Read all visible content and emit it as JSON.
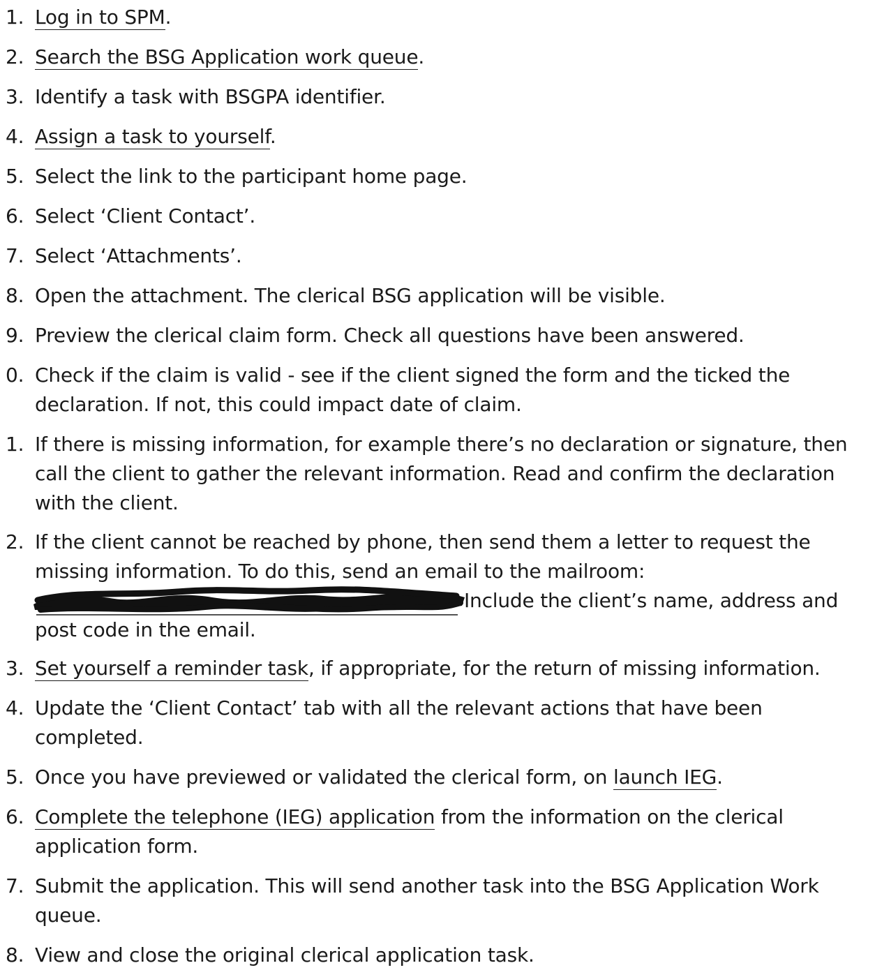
{
  "steps": [
    {
      "num": "1.",
      "parts": [
        {
          "t": "Log in to SPM",
          "link": true
        },
        {
          "t": "."
        }
      ]
    },
    {
      "num": "2.",
      "parts": [
        {
          "t": "Search the BSG Application work queue",
          "link": true
        },
        {
          "t": "."
        }
      ]
    },
    {
      "num": "3.",
      "parts": [
        {
          "t": "Identify a task with BSGPA identifier."
        }
      ]
    },
    {
      "num": "4.",
      "parts": [
        {
          "t": "Assign a task to yourself",
          "link": true
        },
        {
          "t": "."
        }
      ]
    },
    {
      "num": "5.",
      "parts": [
        {
          "t": "Select the link to the participant home page."
        }
      ]
    },
    {
      "num": "6.",
      "parts": [
        {
          "t": "Select ‘Client Contact’."
        }
      ]
    },
    {
      "num": "7.",
      "parts": [
        {
          "t": "Select ‘Attachments’."
        }
      ]
    },
    {
      "num": "8.",
      "parts": [
        {
          "t": "Open the attachment. The clerical BSG application will be visible."
        }
      ]
    },
    {
      "num": "9.",
      "parts": [
        {
          "t": "Preview the clerical claim form. Check all questions have been answered."
        }
      ]
    },
    {
      "num": "0.",
      "lines": [
        [
          {
            "t": "Check if the claim is valid - see if the client signed the form and the ticked the"
          }
        ],
        [
          {
            "t": "declaration. If not, this could impact date of claim."
          }
        ]
      ]
    },
    {
      "num": "1.",
      "lines": [
        [
          {
            "t": "If there is missing information, for example there’s no declaration or signature, then"
          }
        ],
        [
          {
            "t": "call the client to gather the relevant information. Read and confirm the declaration"
          }
        ],
        [
          {
            "t": "with the client."
          }
        ]
      ]
    },
    {
      "num": "2.",
      "lines": [
        [
          {
            "t": "If the client cannot be reached by phone, then send them a letter to request the"
          }
        ],
        [
          {
            "t": "missing information. To do this, send an email to the mailroom:"
          }
        ],
        [
          {
            "redacted": true
          },
          {
            "t": "Include the client’s name, address and"
          }
        ],
        [
          {
            "t": "post code in the email."
          }
        ]
      ]
    },
    {
      "num": "3.",
      "parts": [
        {
          "t": "Set yourself a reminder task",
          "link": true
        },
        {
          "t": ", if appropriate, for the return of missing information."
        }
      ]
    },
    {
      "num": "4.",
      "lines": [
        [
          {
            "t": "Update the ‘Client Contact’ tab with all the relevant actions that have been"
          }
        ],
        [
          {
            "t": "completed."
          }
        ]
      ]
    },
    {
      "num": "5.",
      "parts": [
        {
          "t": "Once you have previewed or validated the clerical form, on "
        },
        {
          "t": "launch IEG",
          "link": true
        },
        {
          "t": "."
        }
      ]
    },
    {
      "num": "6.",
      "lines": [
        [
          {
            "t": "Complete the telephone (IEG) application",
            "link": true
          },
          {
            "t": " from the information on the clerical"
          }
        ],
        [
          {
            "t": "application form."
          }
        ]
      ]
    },
    {
      "num": "7.",
      "lines": [
        [
          {
            "t": "Submit the application. This will send another task into the BSG Application Work"
          }
        ],
        [
          {
            "t": "queue."
          }
        ]
      ]
    },
    {
      "num": "8.",
      "parts": [
        {
          "t": "View and close the original clerical application task."
        }
      ]
    }
  ]
}
